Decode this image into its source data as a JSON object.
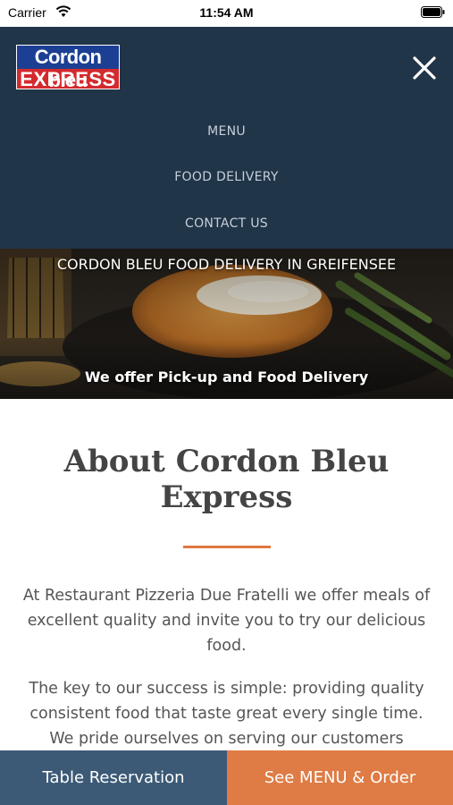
{
  "status_bar": {
    "carrier": "Carrier",
    "time": "11:54 AM",
    "icons": [
      "wifi-icon",
      "battery-icon"
    ]
  },
  "header": {
    "logo": {
      "line1": "Cordon bleu",
      "line2": "EXPRESS"
    },
    "close_icon": "close-icon",
    "colors": {
      "background": "#213549",
      "logo_blue": "#1c3f94",
      "logo_red": "#d32a2f"
    }
  },
  "nav": {
    "items": [
      {
        "label": "MENU"
      },
      {
        "label": "FOOD DELIVERY"
      },
      {
        "label": "CONTACT US"
      }
    ]
  },
  "hero": {
    "title": "CORDON BLEU FOOD DELIVERY IN GREIFENSEE",
    "subtitle": "We offer Pick-up and Food Delivery"
  },
  "about": {
    "heading": "About Cordon Bleu Express",
    "accent_color": "#e07840",
    "paragraphs": [
      "At Restaurant Pizzeria Due Fratelli we offer meals of excellent quality and invite you to try our delicious food.",
      "The key to our success is simple: providing quality consistent food that taste great every single time. We pride ourselves on serving our customers"
    ]
  },
  "actions": {
    "reservation_label": "Table Reservation",
    "order_label": "See MENU & Order",
    "colors": {
      "reservation": "#3c5a76",
      "order": "#df7b44"
    }
  }
}
